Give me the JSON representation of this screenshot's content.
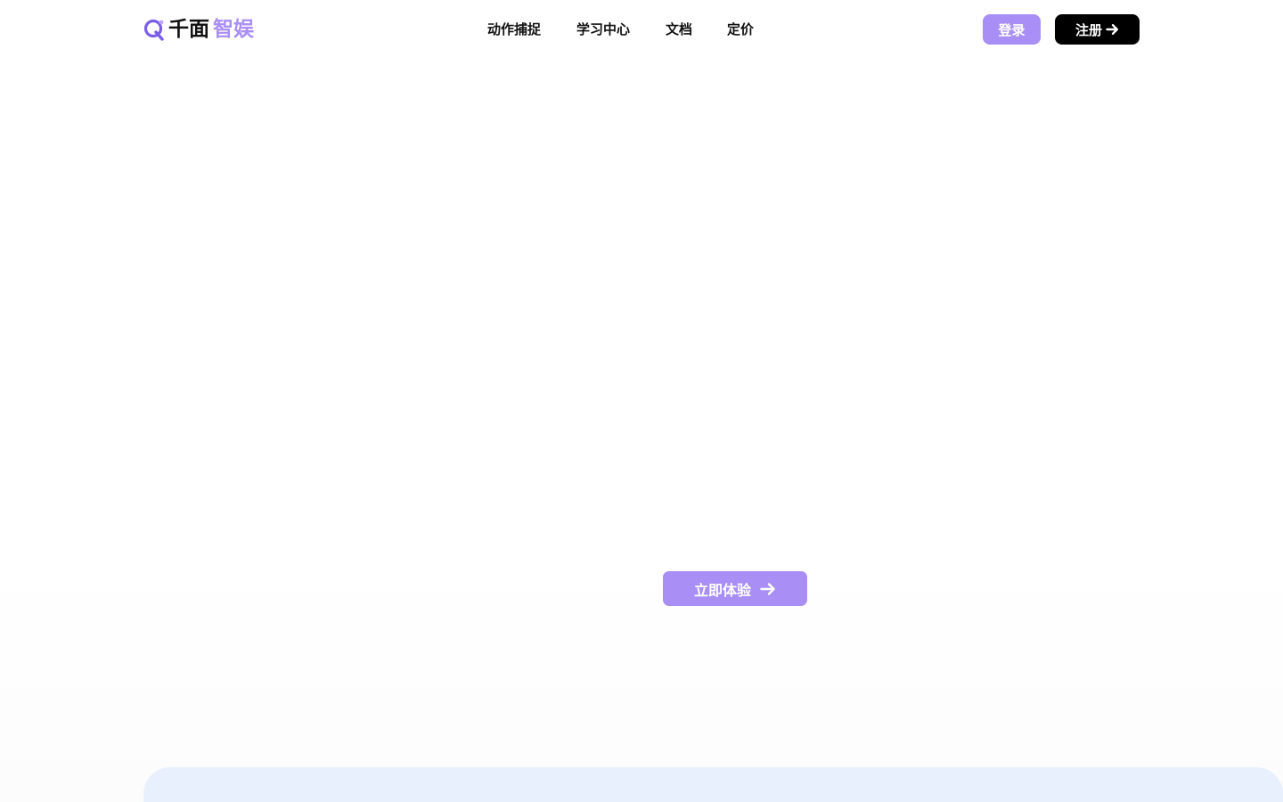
{
  "brand": {
    "name_part1": "千面",
    "name_part2": "智娱",
    "logo_icon": "q-logo-icon",
    "accent_color": "#a98ef5",
    "dark_color": "#111111"
  },
  "nav": {
    "items": [
      {
        "label": "动作捕捉"
      },
      {
        "label": "学习中心"
      },
      {
        "label": "文档"
      },
      {
        "label": "定价"
      }
    ]
  },
  "auth": {
    "login_label": "登录",
    "register_label": "注册",
    "register_icon": "arrow-right-icon"
  },
  "hero": {
    "cta_label": "立即体验",
    "cta_icon": "arrow-right-icon"
  },
  "colors": {
    "button_primary": "#a98ef5",
    "button_dark": "#000000",
    "panel_bg": "#e9f0fd"
  }
}
